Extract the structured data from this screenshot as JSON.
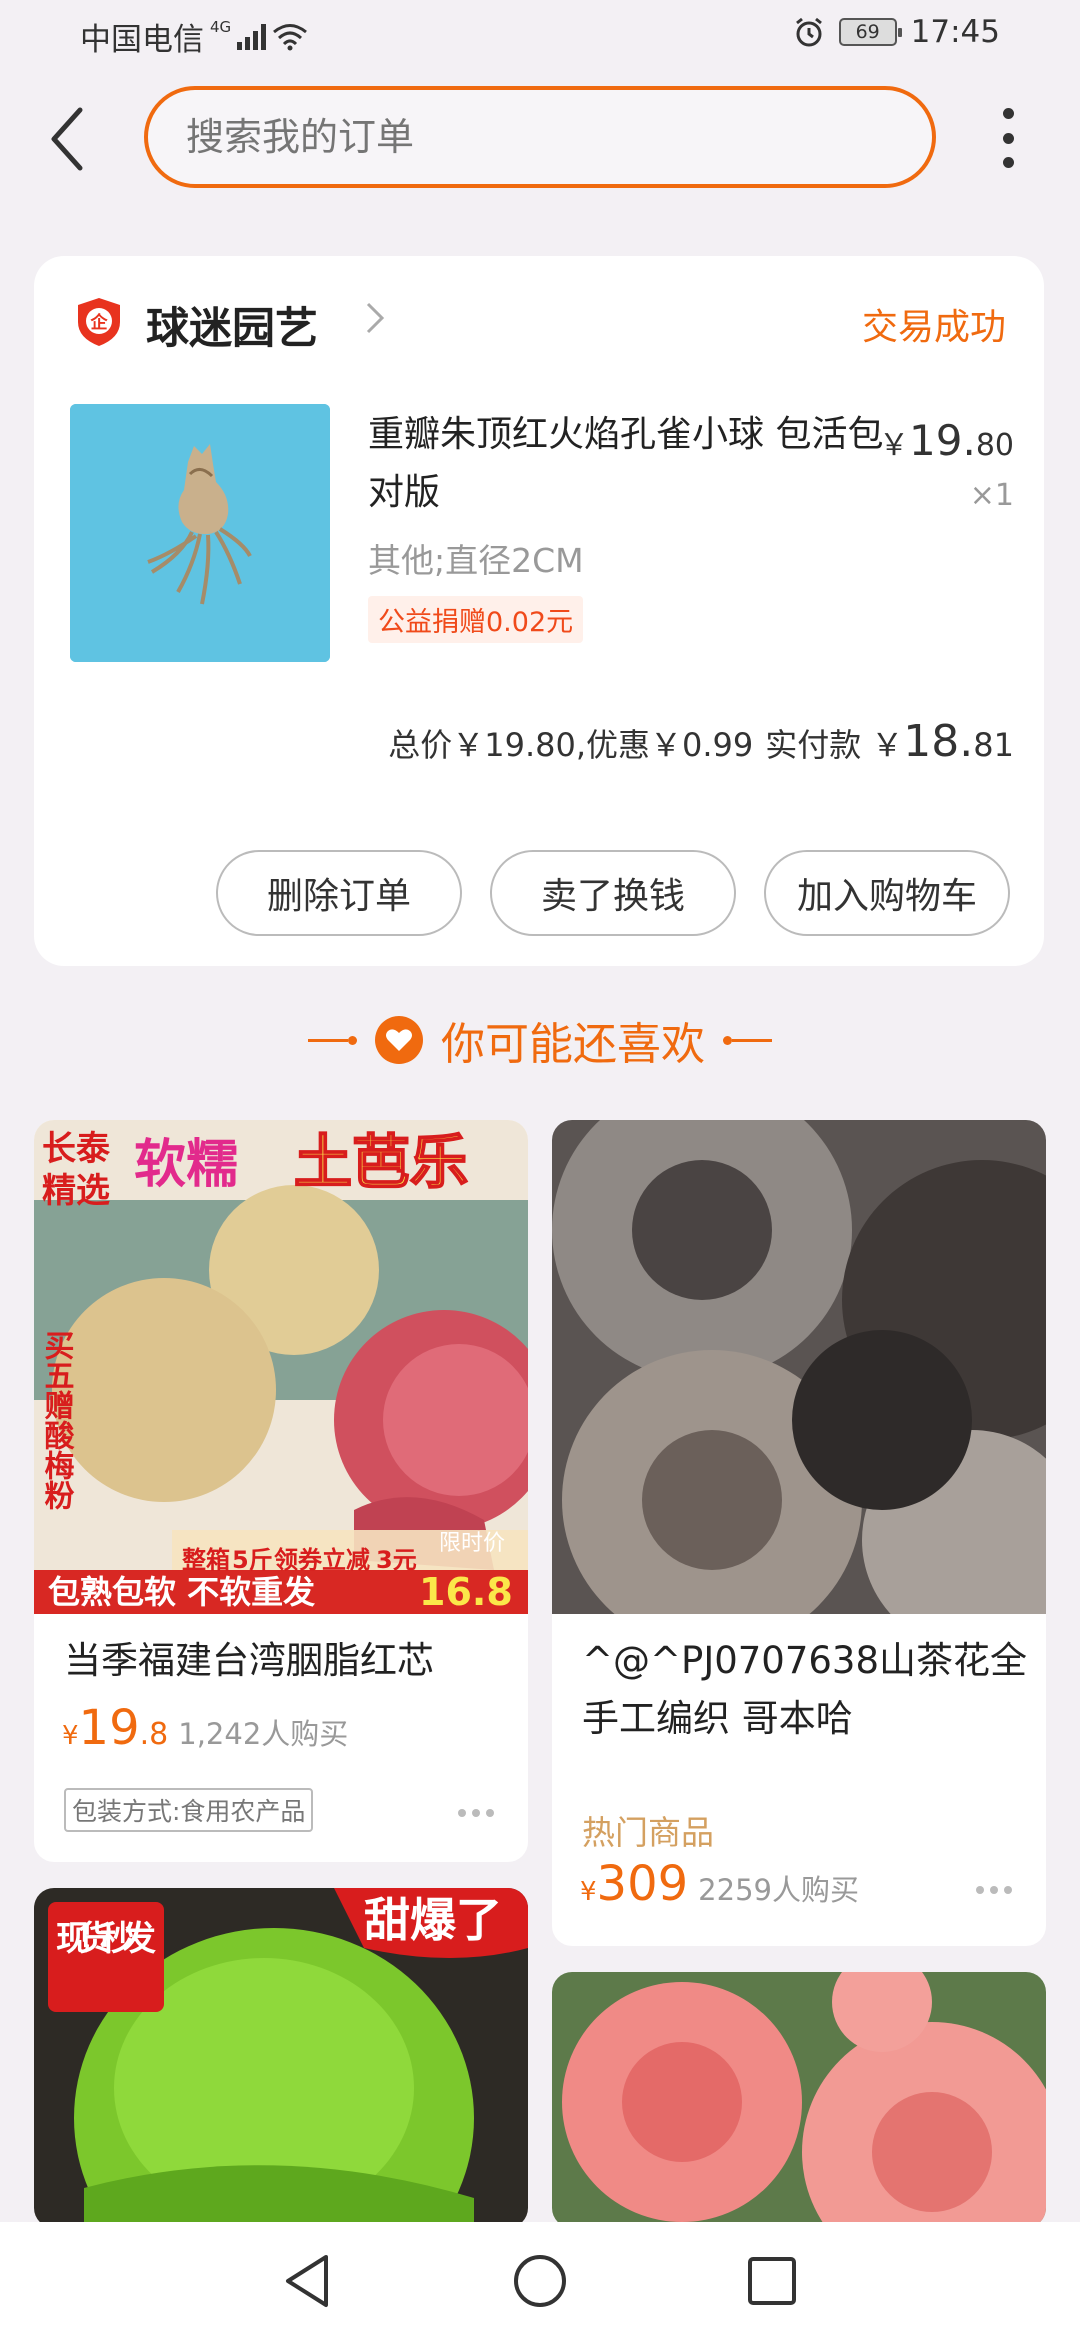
{
  "status_bar": {
    "carrier": "中国电信",
    "network": "4G",
    "battery": "69",
    "time": "17:45"
  },
  "search": {
    "placeholder": "搜索我的订单"
  },
  "order": {
    "shop_name": "球迷园艺",
    "shop_badge": "企",
    "status": "交易成功",
    "product_title": "重瓣朱顶红火焰孔雀小球 包活包对版",
    "price_currency": "￥",
    "price_int": "19.",
    "price_dec": "80",
    "quantity": "×1",
    "spec": "其他;直径2CM",
    "charity": "公益捐赠0.02元",
    "totals_line": "总价￥19.80,优惠￥0.99",
    "paid_label": "实付款",
    "paid_currency": "￥",
    "paid_int": "18.",
    "paid_dec": "81",
    "actions": [
      "删除订单",
      "卖了换钱",
      "加入购物车"
    ]
  },
  "recommend": {
    "title": "你可能还喜欢",
    "items": [
      {
        "name": "当季福建台湾胭脂红芯",
        "currency": "¥",
        "price_int": "19",
        "price_dec": ".8",
        "sold": "1,242人购买",
        "tag": "包装方式:食用农产品",
        "image_text": {
          "brand_top": "长泰",
          "brand_bottom": "精选",
          "headline_a": "软糯",
          "headline_b": "土芭乐",
          "side": "买五赠酸梅粉",
          "promo_a": "整箱",
          "promo_b": "5斤",
          "promo_c": "领券立减",
          "promo_d": "3元",
          "limited": "限时价",
          "bottom": "包熟包软 不软重发",
          "bottom_price": "16.8"
        }
      },
      {
        "name": "^@^PJ0707638山茶花全手工编织 哥本哈",
        "hot": "热门商品",
        "currency": "¥",
        "price_int": "309",
        "sold": "2259人购买"
      },
      {
        "image_text": {
          "corner": "现货秒发",
          "banner": "甜爆了"
        }
      },
      {}
    ]
  },
  "colors": {
    "accent": "#f06a0f",
    "background": "#f3f0f4"
  },
  "icons": [
    "back-arrow-icon",
    "more-vertical-icon",
    "shop-badge-icon",
    "chevron-right-icon",
    "heart-icon",
    "nav-back-icon",
    "nav-home-icon",
    "nav-recents-icon"
  ]
}
